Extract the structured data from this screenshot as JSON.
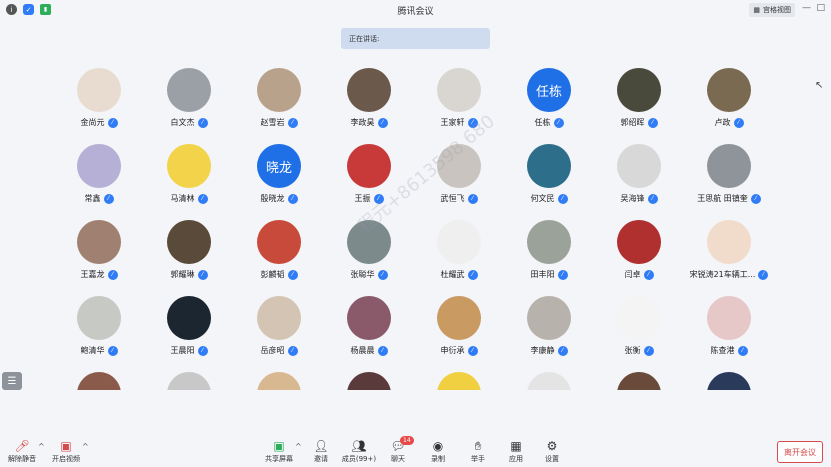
{
  "window": {
    "title": "腾讯会议",
    "view_button": "宫格视图",
    "speaking_label": "正在讲话:"
  },
  "watermark": "程元+8613598 680",
  "participants": [
    {
      "name": "金尚元",
      "avatar_text": "",
      "color": "#e8dcd0"
    },
    {
      "name": "白文杰",
      "avatar_text": "",
      "color": "#9aa0a6"
    },
    {
      "name": "赵雪岩",
      "avatar_text": "",
      "color": "#b8a28c"
    },
    {
      "name": "李政昊",
      "avatar_text": "",
      "color": "#6b5a4c"
    },
    {
      "name": "王家轩",
      "avatar_text": "",
      "color": "#d9d6d2"
    },
    {
      "name": "任栋",
      "avatar_text": "任栋",
      "color": "#1f6fe6"
    },
    {
      "name": "郭绍晖",
      "avatar_text": "",
      "color": "#4a4a3c"
    },
    {
      "name": "卢政",
      "avatar_text": "",
      "color": "#7a6a52"
    },
    {
      "name": "常鑫",
      "avatar_text": "",
      "color": "#b7b0d6"
    },
    {
      "name": "马清林",
      "avatar_text": "",
      "color": "#f2d34a"
    },
    {
      "name": "殷晓龙",
      "avatar_text": "晓龙",
      "color": "#1f6fe6"
    },
    {
      "name": "王振",
      "avatar_text": "",
      "color": "#c83a3a"
    },
    {
      "name": "武恒飞",
      "avatar_text": "",
      "color": "#c9c4bf"
    },
    {
      "name": "何文民",
      "avatar_text": "",
      "color": "#2d6e8a"
    },
    {
      "name": "吴海锋",
      "avatar_text": "",
      "color": "#d8d8d8"
    },
    {
      "name": "王思航 田镇奎",
      "avatar_text": "",
      "color": "#8e9499"
    },
    {
      "name": "王嘉龙",
      "avatar_text": "",
      "color": "#a08070"
    },
    {
      "name": "郭耀琳",
      "avatar_text": "",
      "color": "#5a4a3a"
    },
    {
      "name": "彭麟韬",
      "avatar_text": "",
      "color": "#c84a3a"
    },
    {
      "name": "张聪华",
      "avatar_text": "",
      "color": "#7c8a8c"
    },
    {
      "name": "杜耀武",
      "avatar_text": "",
      "color": "#efefef"
    },
    {
      "name": "田丰阳",
      "avatar_text": "",
      "color": "#9ba29a"
    },
    {
      "name": "闫卓",
      "avatar_text": "",
      "color": "#b03030"
    },
    {
      "name": "宋锐涛21车辆工...",
      "avatar_text": "",
      "color": "#f1dccc"
    },
    {
      "name": "鲍清华",
      "avatar_text": "",
      "color": "#c7c9c5"
    },
    {
      "name": "王晨阳",
      "avatar_text": "",
      "color": "#1c2630"
    },
    {
      "name": "岳彦昭",
      "avatar_text": "",
      "color": "#d4c4b4"
    },
    {
      "name": "杨晨晨",
      "avatar_text": "",
      "color": "#8a5a6a"
    },
    {
      "name": "申衍承",
      "avatar_text": "",
      "color": "#c99a62"
    },
    {
      "name": "李康静",
      "avatar_text": "",
      "color": "#b8b2ac"
    },
    {
      "name": "张衡",
      "avatar_text": "",
      "color": "#f4f4f4"
    },
    {
      "name": "陈查港",
      "avatar_text": "",
      "color": "#e6c8c8"
    },
    {
      "name": "",
      "avatar_text": "",
      "color": "#8a5a4a"
    },
    {
      "name": "",
      "avatar_text": "",
      "color": "#c8c8c8"
    },
    {
      "name": "",
      "avatar_text": "",
      "color": "#d8b890"
    },
    {
      "name": "",
      "avatar_text": "",
      "color": "#5a3a3a"
    },
    {
      "name": "",
      "avatar_text": "",
      "color": "#f0d040"
    },
    {
      "name": "",
      "avatar_text": "",
      "color": "#e4e4e4"
    },
    {
      "name": "",
      "avatar_text": "",
      "color": "#6a4a3a"
    },
    {
      "name": "",
      "avatar_text": "",
      "color": "#2a3a5a"
    }
  ],
  "toolbar": {
    "mute": "解除静音",
    "video": "开启视频",
    "share": "共享屏幕",
    "invite": "邀请",
    "members": "成员(99+)",
    "chat": "聊天",
    "chat_badge": "14",
    "record": "录制",
    "raise_hand": "举手",
    "apps": "应用",
    "settings": "设置",
    "leave": "离开会议"
  }
}
